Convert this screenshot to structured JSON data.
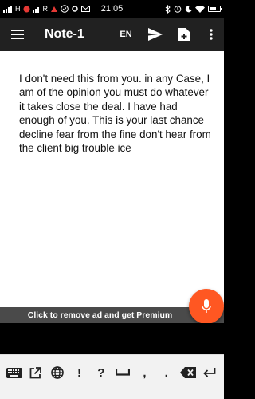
{
  "status_bar": {
    "time": "21:05",
    "left_signal_labels": [
      "H",
      "R"
    ]
  },
  "toolbar": {
    "title": "Note-1",
    "language": "EN"
  },
  "note": {
    "text": "I don't need this from you. in any Case, I am of the opinion you must do whatever it takes close the deal. I have had enough of you. This is your last chance decline fear from the fine don't hear from the client big trouble ice"
  },
  "ad": {
    "label": "Click to remove ad and get Premium"
  },
  "keyboard": {
    "keys": [
      {
        "name": "keyboard-switch-icon",
        "glyph": ""
      },
      {
        "name": "external-link-icon",
        "glyph": ""
      },
      {
        "name": "globe-icon",
        "glyph": ""
      },
      {
        "name": "key-exclamation",
        "glyph": "!"
      },
      {
        "name": "key-question",
        "glyph": "?"
      },
      {
        "name": "space-icon",
        "glyph": ""
      },
      {
        "name": "key-comma",
        "glyph": ","
      },
      {
        "name": "key-period",
        "glyph": "."
      },
      {
        "name": "backspace-icon",
        "glyph": ""
      },
      {
        "name": "enter-icon",
        "glyph": ""
      }
    ]
  },
  "colors": {
    "toolbar_bg": "#212121",
    "fab": "#ff5722",
    "ad_bar": "#4a4a4a"
  }
}
